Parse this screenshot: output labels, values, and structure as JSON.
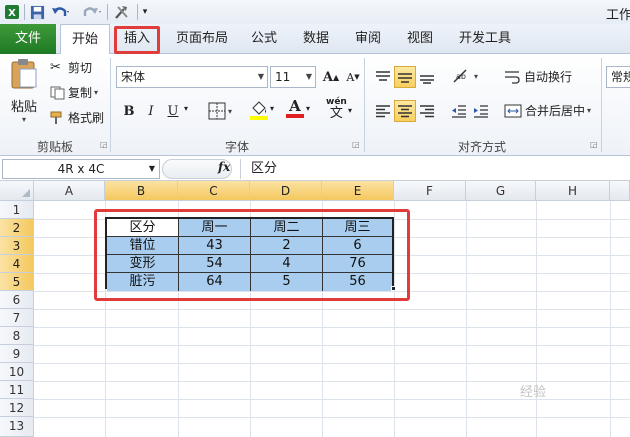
{
  "window": {
    "title": "工作"
  },
  "tabs": [
    "文件",
    "开始",
    "插入",
    "页面布局",
    "公式",
    "数据",
    "审阅",
    "视图",
    "开发工具"
  ],
  "clipboard": {
    "paste": "粘贴",
    "cut": "剪切",
    "copy": "复制",
    "format_painter": "格式刷",
    "group_label": "剪贴板"
  },
  "font": {
    "name": "宋体",
    "size": "11",
    "group_label": "字体",
    "bold": "B",
    "italic": "I",
    "underline": "U",
    "phonetic": "wén",
    "phonetic_char": "文",
    "grow": "A",
    "shrink": "A",
    "font_color_glyph": "A"
  },
  "alignment": {
    "wrap_text": "自动换行",
    "merge_center": "合并后居中",
    "group_label": "对齐方式"
  },
  "number": {
    "format": "常规"
  },
  "formula_bar": {
    "name_box": "4R x 4C",
    "fx": "fx",
    "formula": "区分"
  },
  "grid": {
    "columns": [
      "A",
      "B",
      "C",
      "D",
      "E",
      "F",
      "G",
      "H"
    ],
    "rows": [
      "1",
      "2",
      "3",
      "4",
      "5",
      "6",
      "7",
      "8",
      "9",
      "10",
      "11",
      "12",
      "13"
    ],
    "table": [
      [
        "区分",
        "周一",
        "周二",
        "周三"
      ],
      [
        "错位",
        "43",
        "2",
        "6"
      ],
      [
        "变形",
        "54",
        "4",
        "76"
      ],
      [
        "脏污",
        "64",
        "5",
        "56"
      ]
    ]
  },
  "watermark": "经验",
  "colors": {
    "file_tab": "#1e7a23",
    "highlight": "#e03c3c",
    "selection_fill": "#a9cdef",
    "header_selected": "#f4c85e"
  }
}
